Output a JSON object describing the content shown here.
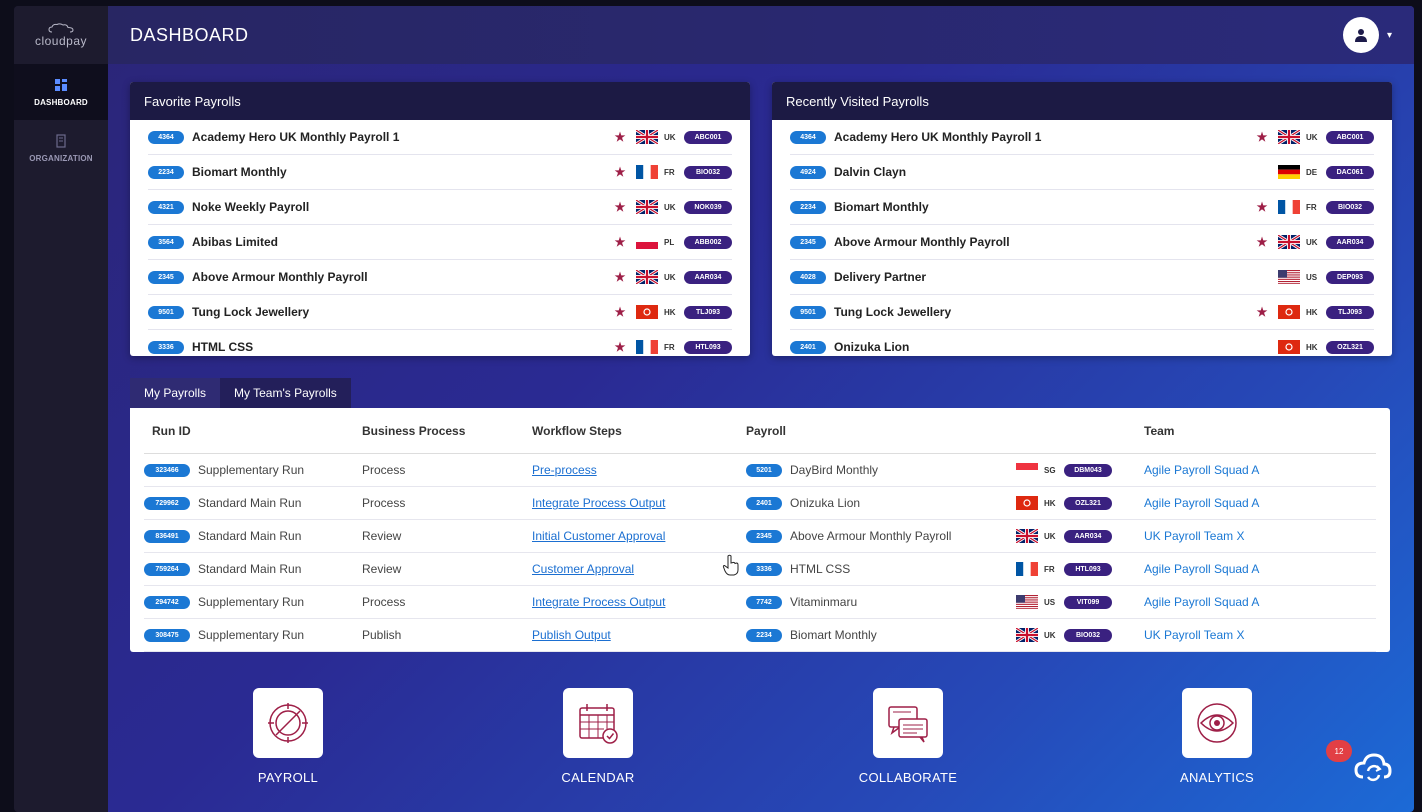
{
  "app": {
    "logo_text": "cloudpay",
    "page_title": "DASHBOARD"
  },
  "sidebar": {
    "items": [
      {
        "label": "DASHBOARD",
        "icon": "dashboard-icon",
        "active": true
      },
      {
        "label": "ORGANIZATION",
        "icon": "organization-icon",
        "active": false
      }
    ]
  },
  "favorites": {
    "title": "Favorite Payrolls",
    "rows": [
      {
        "id": "4364",
        "name": "Academy Hero UK Monthly Payroll 1",
        "starred": true,
        "country": "UK",
        "code": "ABC001"
      },
      {
        "id": "2234",
        "name": "Biomart Monthly",
        "starred": true,
        "country": "FR",
        "code": "BIO032"
      },
      {
        "id": "4321",
        "name": "Noke Weekly Payroll",
        "starred": true,
        "country": "UK",
        "code": "NOK039"
      },
      {
        "id": "3564",
        "name": "Abibas Limited",
        "starred": true,
        "country": "PL",
        "code": "ABB002"
      },
      {
        "id": "2345",
        "name": "Above Armour Monthly Payroll",
        "starred": true,
        "country": "UK",
        "code": "AAR034"
      },
      {
        "id": "9501",
        "name": "Tung Lock Jewellery",
        "starred": true,
        "country": "HK",
        "code": "TLJ093"
      },
      {
        "id": "3336",
        "name": "HTML CSS",
        "starred": true,
        "country": "FR",
        "code": "HTL093"
      }
    ]
  },
  "recent": {
    "title": "Recently Visited Payrolls",
    "rows": [
      {
        "id": "4364",
        "name": "Academy Hero UK Monthly Payroll 1",
        "starred": true,
        "country": "UK",
        "code": "ABC001"
      },
      {
        "id": "4924",
        "name": "Dalvin Clayn",
        "starred": false,
        "country": "DE",
        "code": "DAC061"
      },
      {
        "id": "2234",
        "name": "Biomart Monthly",
        "starred": true,
        "country": "FR",
        "code": "BIO032"
      },
      {
        "id": "2345",
        "name": "Above Armour Monthly Payroll",
        "starred": true,
        "country": "UK",
        "code": "AAR034"
      },
      {
        "id": "4028",
        "name": "Delivery Partner",
        "starred": false,
        "country": "US",
        "code": "DEP093"
      },
      {
        "id": "9501",
        "name": "Tung Lock Jewellery",
        "starred": true,
        "country": "HK",
        "code": "TLJ093"
      },
      {
        "id": "2401",
        "name": "Onizuka Lion",
        "starred": false,
        "country": "HK",
        "code": "OZL321"
      }
    ]
  },
  "tabs": [
    {
      "label": "My Payrolls",
      "active": false
    },
    {
      "label": "My Team's Payrolls",
      "active": true
    }
  ],
  "table": {
    "headers": [
      "Run ID",
      "Business Process",
      "Workflow Steps",
      "Payroll",
      "",
      "Team"
    ],
    "rows": [
      {
        "run_id": "323466",
        "run_type": "Supplementary Run",
        "process": "Process",
        "step": "Pre-process",
        "payroll_id": "5201",
        "payroll": "DayBird Monthly",
        "country": "SG",
        "code": "DBM043",
        "team": "Agile Payroll Squad A"
      },
      {
        "run_id": "729962",
        "run_type": "Standard Main Run",
        "process": "Process",
        "step": "Integrate Process Output",
        "payroll_id": "2401",
        "payroll": "Onizuka Lion",
        "country": "HK",
        "code": "OZL321",
        "team": "Agile Payroll Squad A"
      },
      {
        "run_id": "836491",
        "run_type": "Standard Main Run",
        "process": "Review",
        "step": "Initial Customer Approval",
        "payroll_id": "2345",
        "payroll": "Above Armour Monthly Payroll",
        "country": "UK",
        "code": "AAR034",
        "team": "UK Payroll Team X"
      },
      {
        "run_id": "759264",
        "run_type": "Standard Main Run",
        "process": "Review",
        "step": "Customer Approval",
        "payroll_id": "3336",
        "payroll": "HTML CSS",
        "country": "FR",
        "code": "HTL093",
        "team": "Agile Payroll Squad A"
      },
      {
        "run_id": "294742",
        "run_type": "Supplementary Run",
        "process": "Process",
        "step": "Integrate Process Output",
        "payroll_id": "7742",
        "payroll": "Vitaminmaru",
        "country": "US",
        "code": "VIT099",
        "team": "Agile Payroll Squad A"
      },
      {
        "run_id": "308475",
        "run_type": "Supplementary Run",
        "process": "Publish",
        "step": "Publish Output",
        "payroll_id": "2234",
        "payroll": "Biomart Monthly",
        "country": "UK",
        "code": "BIO032",
        "team": "UK Payroll Team X"
      }
    ]
  },
  "tiles": [
    {
      "label": "PAYROLL",
      "icon": "payroll-icon"
    },
    {
      "label": "CALENDAR",
      "icon": "calendar-icon"
    },
    {
      "label": "COLLABORATE",
      "icon": "collaborate-icon"
    },
    {
      "label": "ANALYTICS",
      "icon": "analytics-icon"
    }
  ],
  "notifications": {
    "count": "12"
  },
  "colors": {
    "id_badge": "#1b78d4",
    "code_badge": "#3a2180",
    "star": "#9e1f47",
    "tile_icon": "#9e1f47"
  }
}
